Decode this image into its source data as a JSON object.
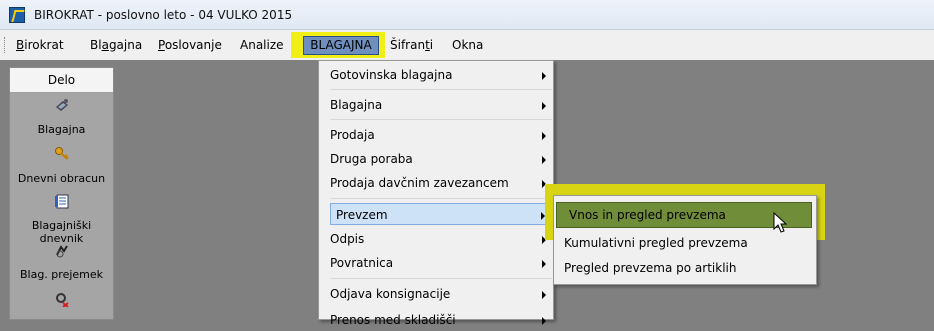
{
  "window": {
    "title": "BIROKRAT - poslovno leto - 04 VULKO 2015"
  },
  "menubar": {
    "items": [
      {
        "label_ul": "B",
        "label_rest": "irokrat"
      },
      {
        "label_pre": "Bl",
        "label_ul": "a",
        "label_rest": "gajna"
      },
      {
        "label_ul": "P",
        "label_rest": "oslovanje"
      },
      {
        "label": "Analize"
      },
      {
        "label": "BLAGAJNA"
      },
      {
        "label_pre": "Šifran",
        "label_ul": "t",
        "label_rest": "i"
      },
      {
        "label": "Okna"
      }
    ]
  },
  "sidebar": {
    "header": "Delo",
    "items": [
      {
        "label": "Blagajna",
        "icon": "register-icon"
      },
      {
        "label": "Dnevni obracun",
        "icon": "key-icon"
      },
      {
        "label": "Blagajniški dnevnik",
        "icon": "journal-icon"
      },
      {
        "label": "Blag. prejemek",
        "icon": "receipt-icon"
      },
      {
        "label": "",
        "icon": "payment-out-icon"
      }
    ]
  },
  "dropdown": {
    "items": [
      {
        "label": "Gotovinska blagajna",
        "has_submenu": true
      },
      {
        "label": "Blagajna",
        "has_submenu": true
      },
      {
        "label": "Prodaja",
        "has_submenu": true
      },
      {
        "label": "Druga poraba",
        "has_submenu": true
      },
      {
        "label": "Prodaja davčnim zavezancem",
        "has_submenu": true
      },
      {
        "label": "Prevzem",
        "has_submenu": true,
        "highlighted": true
      },
      {
        "label": "Odpis",
        "has_submenu": true
      },
      {
        "label": "Povratnica",
        "has_submenu": true
      },
      {
        "label": "Odjava konsignacije",
        "has_submenu": true
      },
      {
        "label": "Prenos med skladišči",
        "has_submenu": true
      }
    ]
  },
  "submenu": {
    "items": [
      {
        "label": "Vnos in pregled prevzema",
        "highlighted": true
      },
      {
        "label": "Kumulativni pregled prevzema"
      },
      {
        "label": "Pregled prevzema po artiklih"
      }
    ]
  },
  "colors": {
    "highlight_yellow": "#f2ef17",
    "active_menu_blue": "#6f8fbe",
    "submenu_active_green": "#708d3a",
    "workspace_gray": "#808080"
  }
}
